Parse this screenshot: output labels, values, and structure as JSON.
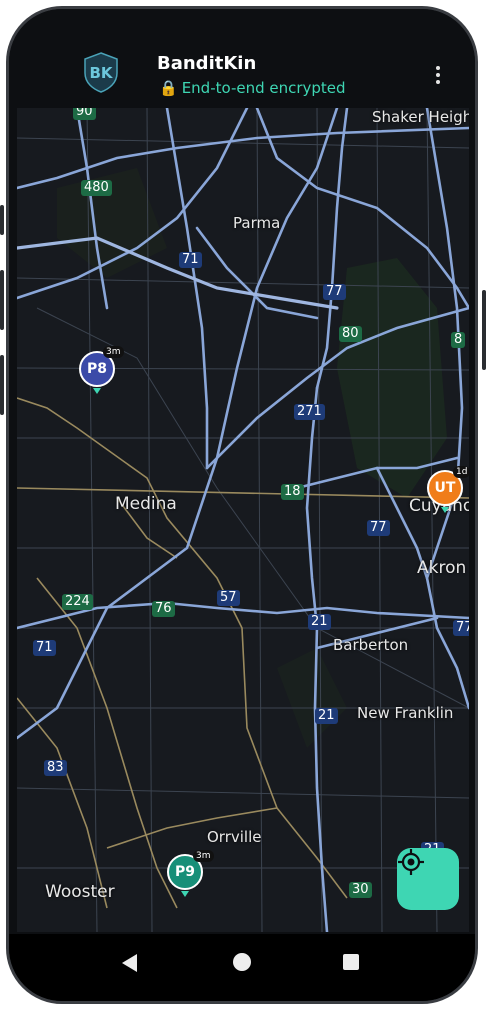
{
  "header": {
    "title": "BanditKin",
    "subtitle": "End-to-end encrypted",
    "lock_icon": "lock-icon",
    "menu_icon": "more-vertical-icon"
  },
  "map": {
    "cities": {
      "shaker_heights": "Shaker Heights",
      "parma": "Parma",
      "medina": "Medina",
      "cuyahoga": "Cuyahog",
      "akron": "Akron",
      "barberton": "Barberton",
      "new_franklin": "New Franklin",
      "orrville": "Orrville",
      "wooster": "Wooster"
    },
    "routes": {
      "r90": "90",
      "r480": "480",
      "r71a": "71",
      "r77a": "77",
      "r80": "80",
      "r8": "8",
      "r271": "271",
      "r18": "18",
      "r77b": "77",
      "r224": "224",
      "r76": "76",
      "r57": "57",
      "r21a": "21",
      "r77c": "77",
      "r71b": "71",
      "r21b": "21",
      "r83": "83",
      "r30": "30",
      "r21c": "21"
    },
    "markers": [
      {
        "label": "P8",
        "badge": "3m",
        "color": "#3b4aa8"
      },
      {
        "label": "UT",
        "badge": "1d",
        "color": "#f07d1a"
      },
      {
        "label": "P9",
        "badge": "3m",
        "color": "#178f78"
      }
    ]
  },
  "locate_button": {
    "icon": "my-location-icon"
  },
  "navbar": {
    "back": "back-icon",
    "home": "home-icon",
    "recents": "recents-icon"
  },
  "colors": {
    "accent": "#3ed6b3",
    "map_bg": "#171a1f",
    "road": "#8aa6d8"
  }
}
